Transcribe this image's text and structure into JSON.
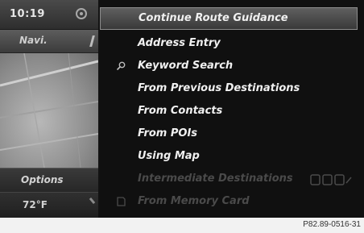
{
  "status": {
    "time": "10:19"
  },
  "left_panel": {
    "nav_label": "Navi.",
    "options_label": "Options",
    "temperature": "72°F"
  },
  "menu": {
    "items": [
      {
        "label": "Continue Route Guidance",
        "state": "selected"
      },
      {
        "label": "Address Entry",
        "state": "normal"
      },
      {
        "label": "Keyword Search",
        "state": "normal",
        "icon": "search-icon"
      },
      {
        "label": "From Previous Destinations",
        "state": "normal"
      },
      {
        "label": "From Contacts",
        "state": "normal"
      },
      {
        "label": "From POIs",
        "state": "normal"
      },
      {
        "label": "Using Map",
        "state": "normal"
      },
      {
        "label": "Intermediate Destinations",
        "state": "disabled"
      },
      {
        "label": "From Memory Card",
        "state": "disabled",
        "icon": "memory-card-icon"
      }
    ]
  },
  "caption": "P82.89-0516-31",
  "colors": {
    "selected_highlight": "#5f5f5f",
    "text": "#f0f0f0",
    "disabled_text": "#4a4a4a"
  }
}
